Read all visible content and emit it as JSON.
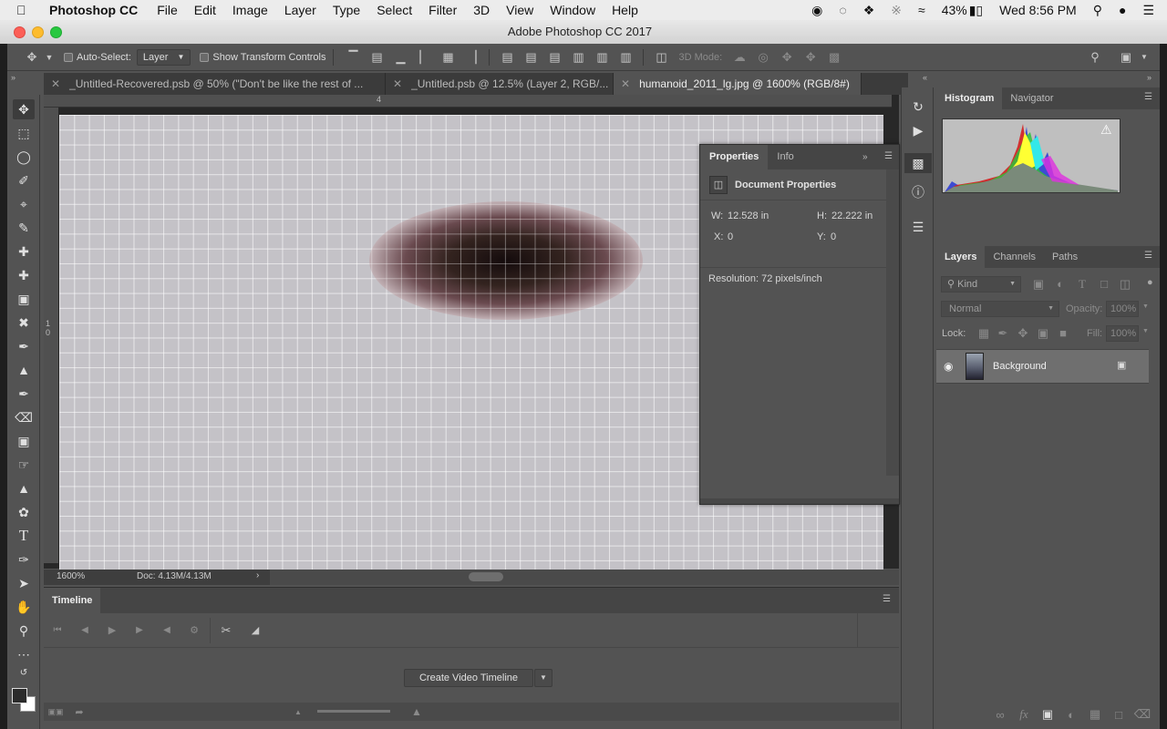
{
  "menubar": {
    "app_name": "Photoshop CC",
    "items": [
      "File",
      "Edit",
      "Image",
      "Layer",
      "Type",
      "Select",
      "Filter",
      "3D",
      "View",
      "Window",
      "Help"
    ],
    "battery": "43%",
    "clock": "Wed 8:56 PM"
  },
  "window": {
    "title": "Adobe Photoshop CC 2017"
  },
  "options": {
    "auto_select_label": "Auto-Select:",
    "auto_select_value": "Layer",
    "show_transform_label": "Show Transform Controls",
    "mode_3d_label": "3D Mode:"
  },
  "tabs": [
    {
      "label": "_Untitled-Recovered.psb @ 50% (\"Don't be like  the rest of ..."
    },
    {
      "label": "_Untitled.psb @ 12.5% (Layer 2, RGB/..."
    },
    {
      "label": "humanoid_2011_lg.jpg @ 1600% (RGB/8#)"
    }
  ],
  "ruler": {
    "top_mark": "4",
    "left_mark_1": "1",
    "left_mark_2": "0"
  },
  "status": {
    "zoom": "1600%",
    "doc": "Doc: 4.13M/4.13M"
  },
  "properties": {
    "tab_properties": "Properties",
    "tab_info": "Info",
    "section": "Document Properties",
    "w_label": "W:",
    "w_value": "12.528 in",
    "h_label": "H:",
    "h_value": "22.222 in",
    "x_label": "X:",
    "x_value": "0",
    "y_label": "Y:",
    "y_value": "0",
    "resolution": "Resolution: 72 pixels/inch"
  },
  "histogram_panel": {
    "tab_histogram": "Histogram",
    "tab_navigator": "Navigator"
  },
  "layers_panel": {
    "tab_layers": "Layers",
    "tab_channels": "Channels",
    "tab_paths": "Paths",
    "kind_label": "Kind",
    "blend_mode": "Normal",
    "opacity_label": "Opacity:",
    "opacity_value": "100%",
    "lock_label": "Lock:",
    "fill_label": "Fill:",
    "fill_value": "100%",
    "layer_name": "Background"
  },
  "timeline": {
    "title": "Timeline",
    "create_button": "Create Video Timeline"
  }
}
